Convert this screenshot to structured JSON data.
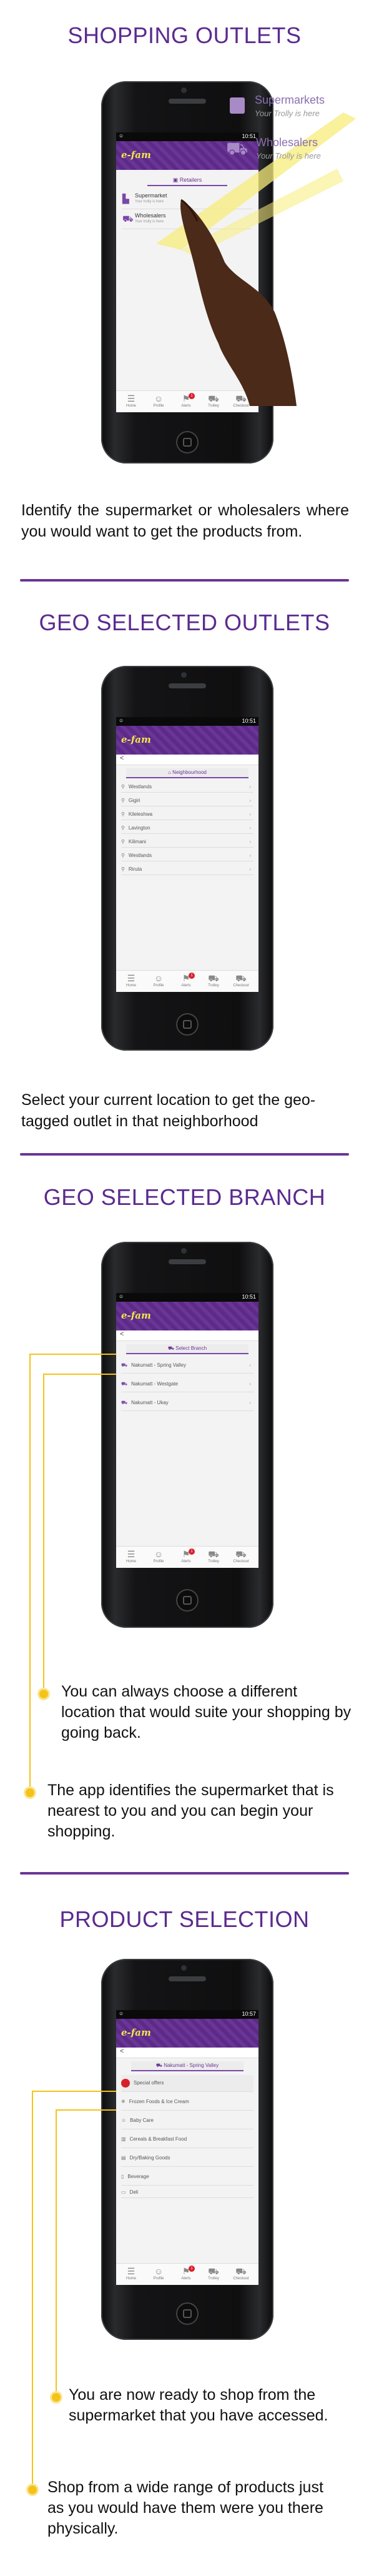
{
  "sections": [
    {
      "title": "SHOPPING OUTLETS",
      "description": "Identify the supermarket or wholesalers where you would want to get the products from.",
      "callouts": [
        {
          "title": "Supermarkets",
          "subtitle": "Your Trolly is here"
        },
        {
          "title": "Wholesalers",
          "subtitle": "Your Trolly is here"
        }
      ],
      "screen": {
        "time": "10:51",
        "logo": "e-fam",
        "tab_title": "Retailers",
        "items": [
          {
            "label": "Supermarket",
            "sub": "Your trolly is here"
          },
          {
            "label": "Wholesalers",
            "sub": "Your trolly is here"
          }
        ]
      }
    },
    {
      "title": "GEO SELECTED OUTLETS",
      "description": "Select your current location to get the geo-tagged outlet in that neighborhood",
      "screen": {
        "time": "10:51",
        "logo": "e-fam",
        "back": "<",
        "pill": "Neighbourhood",
        "items": [
          "Westlands",
          "Gigiri",
          "Kileleshwa",
          "Lavington",
          "Kilimani",
          "Westlands",
          "Riruta"
        ]
      }
    },
    {
      "title": "GEO SELECTED BRANCH",
      "screen": {
        "time": "10:51",
        "logo": "e-fam",
        "back": "<",
        "pill": "Select Branch",
        "items": [
          "Nakumatt - Spring Valley",
          "Nakumatt - Westgate",
          "Nakumatt - Ukay"
        ]
      },
      "bullets": [
        "You can always choose a different location that would suite your shopping  by going back.",
        "The app identifies the supermarket that is nearest to you and you can begin your shopping."
      ]
    },
    {
      "title": "PRODUCT SELECTION",
      "screen": {
        "time": "10:57",
        "logo": "e-fam",
        "back": "<",
        "pill": "Nakumatt - Spring Valley",
        "items": [
          "Special offers",
          "Frozen Foods & Ice Cream",
          "Baby Care",
          "Cereals & Breakfast Food",
          "Dry/Baking Goods",
          "Beverage",
          "Deli"
        ]
      },
      "bullets": [
        "You are now ready to shop from the supermarket that you have accessed.",
        "Shop from a wide range of products just as you would have them were you there physically."
      ]
    }
  ],
  "tabbar": [
    "Home",
    "Profile",
    "Alerts",
    "Trolley",
    "Checkout"
  ],
  "badge_count": "1",
  "accent": "#5b2a8e",
  "bullet_color": "#f4c31a"
}
